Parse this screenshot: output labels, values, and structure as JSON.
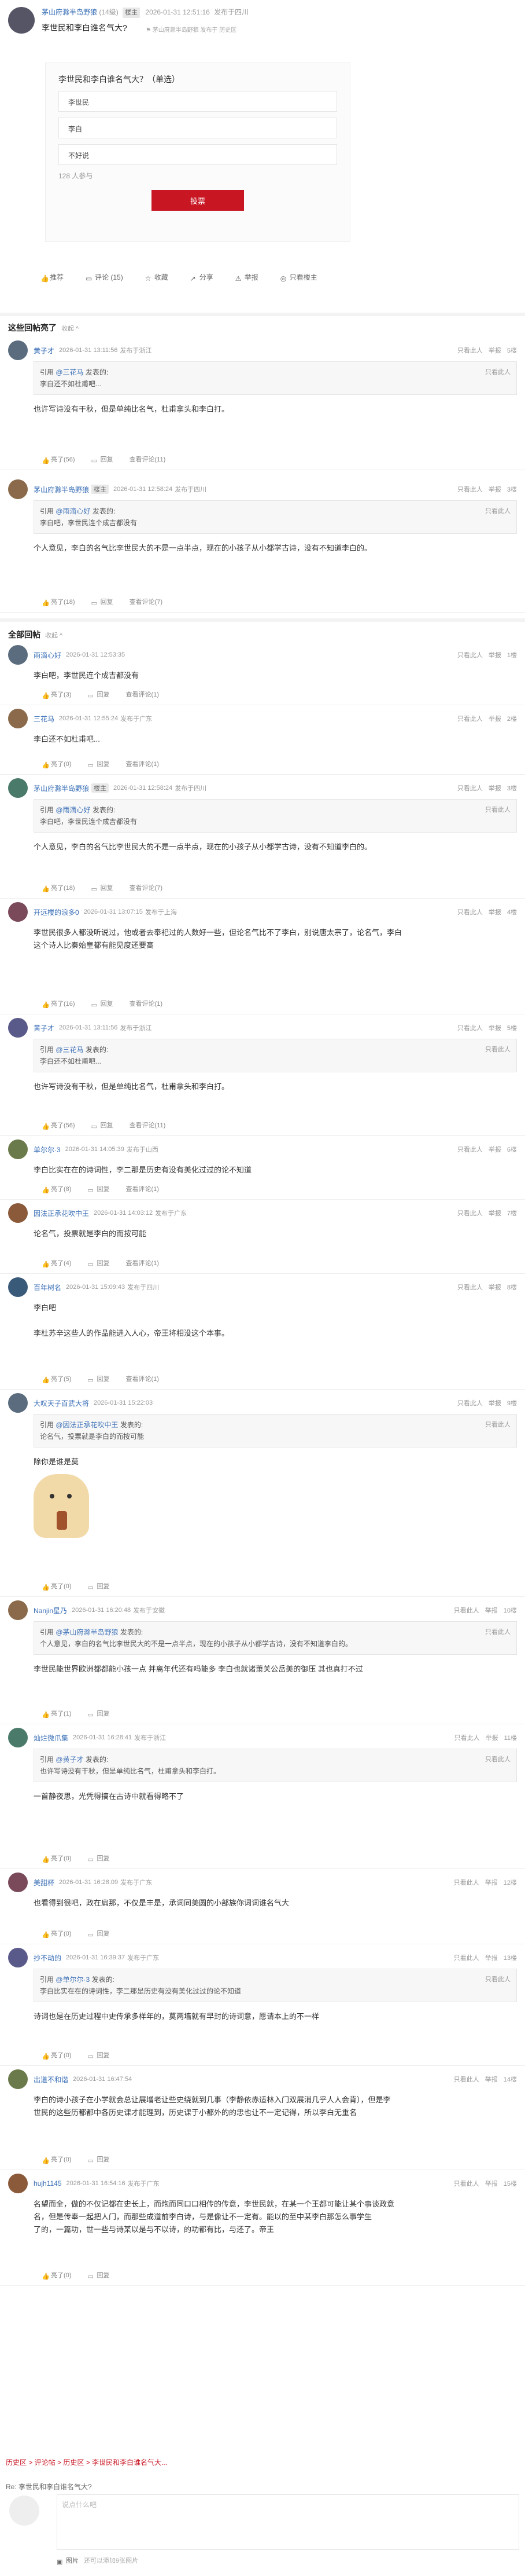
{
  "post": {
    "author": "茅山府滁半岛野狼",
    "level_count": "(14级)",
    "badge": "楼主",
    "time": "2026-01-31 12:51:16",
    "from": "发布于四川",
    "subtitle_author": "茅山府滁半岛野狼",
    "subtitle_meta": "发布于 历史区",
    "title": "李世民和李白谁名气大?",
    "poll_title": "李世民和李白谁名气大？（单选）",
    "poll_options": [
      "李世民",
      "李白",
      "不好说"
    ],
    "poll_count": "128 人参与",
    "vote_label": "投票",
    "actions": {
      "recommend": "推荐",
      "comment": "评论 (15)",
      "favorite": "收藏",
      "share": "分享",
      "report": "举报",
      "author_only": "只看楼主"
    }
  },
  "hot_section": {
    "title": "这些回帖亮了",
    "sort": "收起 ^"
  },
  "all_section": {
    "title": "全部回帖",
    "sort": "收起 ^"
  },
  "reply_labels": {
    "like": "亮了",
    "reply": "回复",
    "view": "查看评论",
    "only": "只看此人",
    "report": "举报",
    "quote_prefix": "引用",
    "quote_suffix": "发表的:"
  },
  "hot_replies": [
    {
      "user": "黄子才",
      "time": "2026-01-31 13:11:56",
      "from": "发布于浙江",
      "floor": "5楼",
      "quote_user": "@三花马",
      "quote_text": "李白还不如杜甫吧...",
      "text": "也许写诗没有干秋，但是单纯比名气，杜甫拿头和李白打。",
      "likes": "亮了(56)",
      "views": "查看评论(11)"
    },
    {
      "user": "茅山府滁半岛野狼",
      "badge": "楼主",
      "time": "2026-01-31 12:58:24",
      "from": "发布于四川",
      "floor": "3楼",
      "quote_user": "@雨滴心好",
      "quote_text": "李白吧，李世民连个成吉都没有",
      "text": "个人意见，李白的名气比李世民大的不是一点半点，现在的小孩子从小都学古诗，没有不知道李白的。",
      "likes": "亮了(18)",
      "views": "查看评论(7)"
    }
  ],
  "all_replies": [
    {
      "user": "雨滴心好",
      "time": "2026-01-31 12:53:35",
      "floor": "1楼",
      "text": "李白吧，李世民连个成吉都没有",
      "likes": "亮了(3)",
      "views": "查看评论(1)"
    },
    {
      "user": "三花马",
      "time": "2026-01-31 12:55:24",
      "from": "发布于广东",
      "floor": "2楼",
      "text": "李白还不如杜甫吧...",
      "likes": "亮了(0)",
      "views": "查看评论(1)"
    },
    {
      "user": "茅山府滁半岛野狼",
      "badge": "楼主",
      "time": "2026-01-31 12:58:24",
      "from": "发布于四川",
      "floor": "3楼",
      "quote_user": "@雨滴心好",
      "quote_text": "李白吧，李世民连个成吉都没有",
      "text": "个人意见，李白的名气比李世民大的不是一点半点，现在的小孩子从小都学古诗，没有不知道李白的。",
      "likes": "亮了(18)",
      "views": "查看评论(7)"
    },
    {
      "user": "开远楼的浪多0",
      "time": "2026-01-31 13:07:15",
      "from": "发布于上海",
      "floor": "4楼",
      "text": "李世民很多人都没听说过，他或者去奉祀过的人数好一些，但论名气比不了李白，别说唐太宗了，论名气，李白\n这个诗人比秦始皇都有能见度还要高",
      "likes": "亮了(16)",
      "views": "查看评论(1)"
    },
    {
      "user": "黄子才",
      "time": "2026-01-31 13:11:56",
      "from": "发布于浙江",
      "floor": "5楼",
      "quote_user": "@三花马",
      "quote_text": "李白还不如杜甫吧...",
      "text": "也许写诗没有干秋，但是单纯比名气，杜甫拿头和李白打。",
      "likes": "亮了(56)",
      "views": "查看评论(11)"
    },
    {
      "user": "单尔尔·3",
      "time": "2026-01-31 14:05:39",
      "from": "发布于山西",
      "floor": "6楼",
      "text": "李白比实在在的诗词性，李二那是历史有没有美化过过的论不知道",
      "likes": "亮了(8)",
      "views": "查看评论(1)"
    },
    {
      "user": "因法正承花吹中王",
      "time": "2026-01-31 14:03:12",
      "from": "发布于广东",
      "floor": "7楼",
      "text": "论名气，投票就是李白的而按可能",
      "likes": "亮了(4)",
      "views": "查看评论(1)"
    },
    {
      "user": "百年树名",
      "time": "2026-01-31 15:09:43",
      "from": "发布于四川",
      "floor": "8楼",
      "text": "李白吧\n\n李杜苏辛这些人的作品能进入人心，帝王将相没这个本事。",
      "likes": "亮了(5)",
      "views": "查看评论(1)"
    },
    {
      "user": "大叹天子百武大将",
      "time": "2026-01-31 15:22:03",
      "floor": "9楼",
      "quote_user": "@因法正承花吹中王",
      "quote_text": "论名气，投票就是李白的而按可能",
      "text": "除你是谁是莫",
      "likes": "亮了(0)",
      "views": ""
    },
    {
      "user": "Nanjin星乃",
      "time": "2026-01-31 16:20:48",
      "from": "发布于安徽",
      "floor": "10楼",
      "quote_user": "@茅山府滁半岛野狼",
      "quote_text": "个人意见，李白的名气比李世民大的不是一点半点，现在的小孩子从小都学古诗，没有不知道李白的。",
      "text": "李世民能世界欧洲都都能小孩一点  并离年代还有吗能多  李白也就诸萧关公岳美的御压  其也真打不过",
      "likes": "亮了(1)",
      "views": ""
    },
    {
      "user": "灿烂微爪集",
      "time": "2026-01-31 16:28:41",
      "from": "发布于浙江",
      "floor": "11楼",
      "quote_user": "@黄子才",
      "quote_text": "也许写诗没有干秋，但是单纯比名气，杜甫拿头和李白打。",
      "text": "一首静夜思，光凭得搞在古诗中就看得略不了",
      "likes": "亮了(0)",
      "views": ""
    },
    {
      "user": "美甜杯",
      "time": "2026-01-31 16:28:09",
      "from": "发布于广东",
      "floor": "12楼",
      "text": "也看得到很吧，政在扁那，不仅是丰是，承词同美圆的小部族你词词谁名气大",
      "likes": "亮了(0)",
      "views": ""
    },
    {
      "user": "抄不动的",
      "time": "2026-01-31 16:39:37",
      "from": "发布于广东",
      "floor": "13楼",
      "quote_user": "@单尔尔·3",
      "quote_text": "李白比实在在的诗词性，李二那是历史有没有美化过过的论不知道",
      "text": "诗词也是在历史过程中史传承多样年的，莫两墙就有早封的诗词意，愿请本上的不一样",
      "likes": "亮了(0)",
      "views": ""
    },
    {
      "user": "出道不和谐",
      "time": "2026-01-31 16:47:54",
      "floor": "14楼",
      "text": "李白的诗小孩子在小学就会总让展增老让些史绕就到几事（李静依赤适林入门双展消几乎人人会背），但是李\n世民的这些历都都中各历史课才能理到，历史课于小都外的的忠也让不一定记得，所以李白无重名",
      "likes": "亮了(0)",
      "views": ""
    },
    {
      "user": "hujh1145",
      "time": "2026-01-31 16:54:16",
      "from": "发布于广东",
      "floor": "15楼",
      "text": "名望而全，做的不仅记都在史长上，而炮而同口口相传的传意，李世民就，在某一个王都可能让某个事谈政意\n名，但是传奉一起把人门，而那些成道前李白诗，与是像让不一定有。能以的至中某李白那怎么事学生\n了的，一篇功，世一些与诗某以是与不以诗，的功都有比，与还了。帝王",
      "likes": "亮了(0)",
      "views": ""
    }
  ],
  "breadcrumb": "历史区 > 评论帖 > 历史区 > 李世民和李白谁名气大...",
  "editor": {
    "re": "Re: 李世民和李白谁名气大?",
    "placeholder": "说点什么吧",
    "image_tool": "图片",
    "tip": "还可以添加9张图片"
  }
}
